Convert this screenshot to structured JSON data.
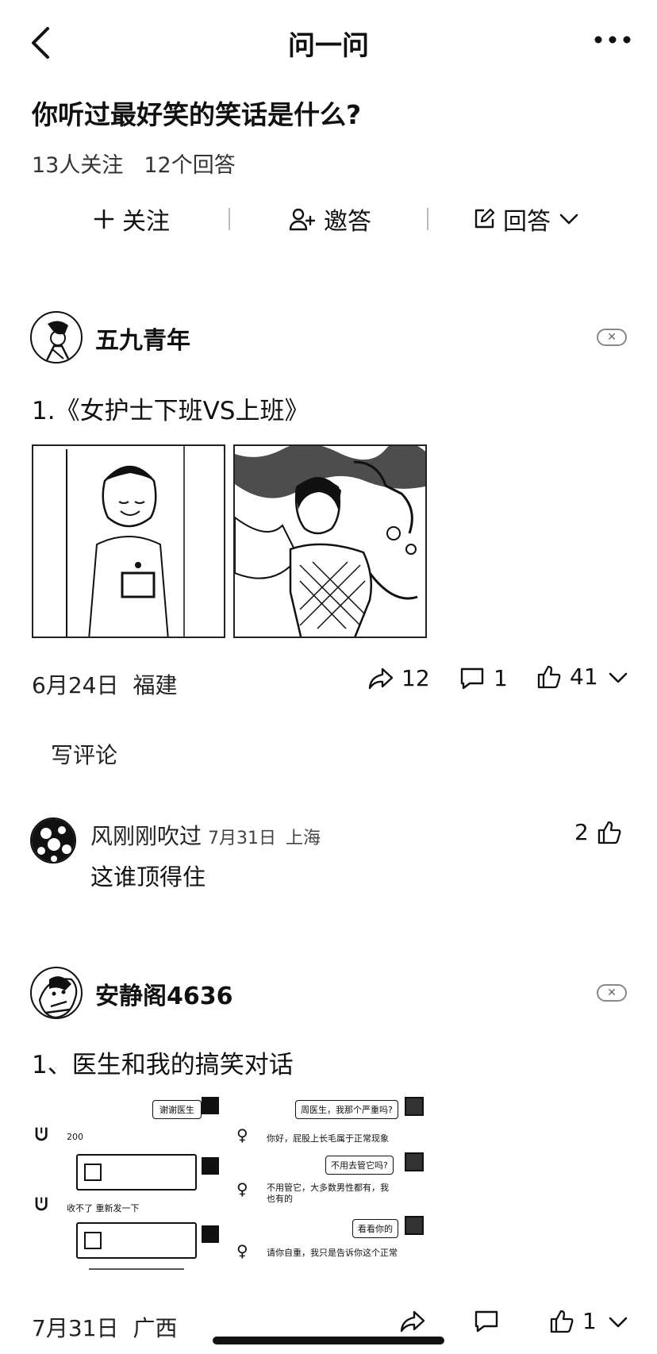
{
  "nav": {
    "title": "问一问",
    "back_icon": "chevron-left-icon",
    "more_icon": "more-horizontal-icon"
  },
  "question": {
    "title": "你听过最好笑的笑话是什么?",
    "followers": "13人关注",
    "answers_count": "12个回答"
  },
  "actions": {
    "follow": "关注",
    "invite": "邀答",
    "answer": "回答"
  },
  "answers": [
    {
      "author": "五九青年",
      "title": "1.《女护士下班VS上班》",
      "date": "6月24日",
      "location": "福建",
      "shares": "12",
      "comments": "1",
      "likes": "41",
      "write_comment": "写评论",
      "comment": {
        "user": "风刚刚吹过",
        "date": "7月31日",
        "location": "上海",
        "likes": "2",
        "text": "这谁顶得住"
      }
    },
    {
      "author": "安静阁4636",
      "title": "1、医生和我的搞笑对话",
      "date": "7月31日",
      "location": "广西",
      "likes": "1",
      "chat_lines_right": [
        "谢谢医生",
        "周医生，我那个严重吗?",
        "不用去管它吗?",
        "看看你的"
      ],
      "chat_lines_left": [
        "200",
        "收不了 重新发一下"
      ],
      "chat_lines_doctor": [
        "你好，屁股上长毛属于正常现象",
        "不用管它，大多数男性都有，我也有的",
        "请你自重，我只是告诉你这个正常"
      ]
    }
  ]
}
